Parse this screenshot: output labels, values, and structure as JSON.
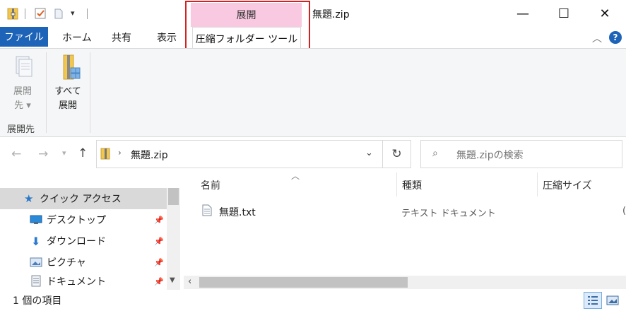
{
  "window": {
    "title": "無題.zip",
    "minimize": "—",
    "maximize": "☐",
    "close": "✕"
  },
  "context_tab": {
    "group": "展開",
    "tab": "圧縮フォルダー ツール",
    "group_color": "#f9c8e1",
    "highlight_color": "#d61f1f"
  },
  "ribbon_tabs": {
    "file": "ファイル",
    "home": "ホーム",
    "share": "共有",
    "view": "表示"
  },
  "ribbon": {
    "extract_to_l1": "展開",
    "extract_to_l2": "先",
    "extract_all_l1": "すべて",
    "extract_all_l2": "展開",
    "group_label": "展開先"
  },
  "address": {
    "path": "無題.zip"
  },
  "search": {
    "placeholder": "無題.zipの検索"
  },
  "nav_pane": {
    "items": [
      {
        "label": "クイック アクセス",
        "icon": "star-icon"
      },
      {
        "label": "デスクトップ",
        "icon": "desktop-icon"
      },
      {
        "label": "ダウンロード",
        "icon": "download-icon"
      },
      {
        "label": "ピクチャ",
        "icon": "picture-icon"
      },
      {
        "label": "ドキュメント",
        "icon": "document-icon"
      }
    ]
  },
  "columns": {
    "name": "名前",
    "type": "種類",
    "size": "圧縮サイズ"
  },
  "files": [
    {
      "name": "無題.txt",
      "type": "テキスト ドキュメント",
      "size_partial": "("
    }
  ],
  "status": {
    "count": "1 個の項目"
  },
  "colors": {
    "accent": "#1d63b8",
    "selection": "#d9d9d9"
  }
}
